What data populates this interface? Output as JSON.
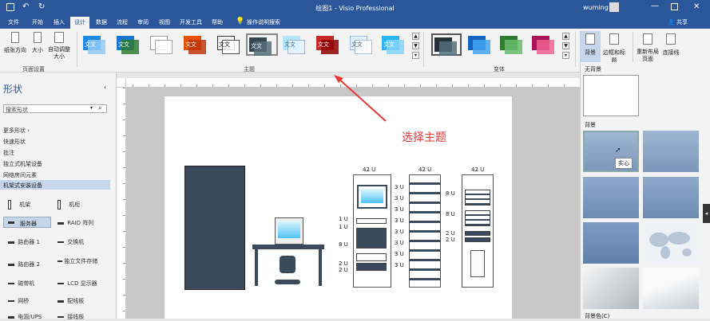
{
  "titlebar": {
    "title": "绘图1 - Visio Professional",
    "user": "wuming",
    "share": "共享"
  },
  "tabs": [
    "文件",
    "开始",
    "插入",
    "设计",
    "数据",
    "流程",
    "审阅",
    "视图",
    "开发工具",
    "帮助"
  ],
  "tell_me": "操作说明搜索",
  "ribbon": {
    "page_setup": {
      "btn1": "纸张方向",
      "btn2": "大小",
      "btn3": "自动调整大小",
      "group": "页面设置"
    },
    "themes_group": "主题",
    "theme_sample": "文文",
    "variants_group": "变体",
    "backgrounds": {
      "bg": "背景",
      "borders": "边框和标题",
      "relayout": "重新布局页面",
      "connectors": "连接线"
    }
  },
  "annotation": "选择主题",
  "shapes_panel": {
    "title": "形状",
    "search_placeholder": "搜索形状",
    "categories": [
      "更多形状",
      "快速形状",
      "批注",
      "独立式机架设备",
      "网络房间元素",
      "机架式安装设备"
    ],
    "items": [
      [
        "机架",
        "机柜"
      ],
      [
        "服务器",
        "RAID 阵列"
      ],
      [
        "路由器 1",
        "交换机"
      ],
      [
        "路由器 2",
        "独立文件存储"
      ],
      [
        "磁带机",
        "LCD 显示器"
      ],
      [
        "网桥",
        "配线板"
      ],
      [
        "电源/UPS",
        "接线板"
      ]
    ]
  },
  "rack_labels": {
    "top": "42 U",
    "u3": "3 U",
    "u1": "1 U",
    "u8": "8 U",
    "u2": "2 U"
  },
  "backgrounds_panel": {
    "none": "无背景",
    "bg": "背景",
    "tooltip": "实心",
    "more": "背景色(C)"
  },
  "colors": {
    "accent": "#2b579a",
    "annotation": "#e53935"
  }
}
